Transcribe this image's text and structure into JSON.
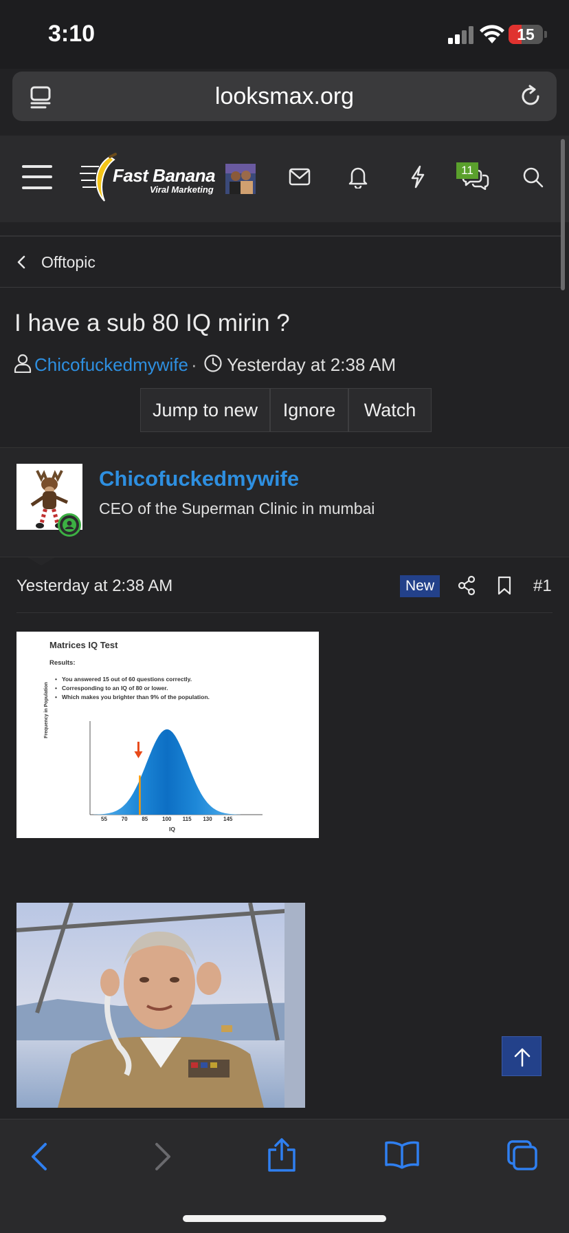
{
  "status_bar": {
    "time": "3:10",
    "battery": "15",
    "battery_level_percent": 15
  },
  "browser": {
    "url": "looksmax.org"
  },
  "header": {
    "logo_line1": "Fast Banana",
    "logo_line2": "Viral Marketing",
    "conversations_badge": "11"
  },
  "breadcrumb": {
    "label": "Offtopic"
  },
  "thread": {
    "title": "I have a sub 80 IQ mirin ?",
    "author": "Chicofuckedmywife",
    "separator": "·",
    "date": "Yesterday at 2:38 AM",
    "buttons": {
      "jump_to_new": "Jump to new",
      "ignore": "Ignore",
      "watch": "Watch"
    }
  },
  "post": {
    "username": "Chicofuckedmywife",
    "user_title": "CEO of the Superman Clinic in mumbai",
    "date": "Yesterday at 2:38 AM",
    "new_badge": "New",
    "number": "#1"
  },
  "iq_image": {
    "title": "Matrices IQ Test",
    "results_label": "Results:",
    "bullets": [
      "You answered 15 out of 60 questions correctly.",
      "Corresponding to an IQ of 80 or lower.",
      "Which makes you brighter than 9% of the population."
    ],
    "y_label": "Frequency in Population",
    "x_label": "IQ",
    "x_ticks": [
      "55",
      "70",
      "85",
      "100",
      "115",
      "130",
      "145"
    ],
    "marker_iq": 80,
    "colors": {
      "curve": "#1e88d8",
      "marker": "#ff9900",
      "arrow": "#e84a1a"
    }
  },
  "icons": {
    "tabs": "tabs-icon",
    "reload": "reload-icon",
    "menu": "hamburger-icon",
    "inbox": "envelope-icon",
    "alerts": "bell-icon",
    "whats_new": "lightning-icon",
    "conversations": "chat-icon",
    "search": "search-icon",
    "back": "chevron-left-icon",
    "share": "share-icon",
    "bookmark": "bookmark-icon",
    "scroll_top": "arrow-up-icon"
  },
  "colors": {
    "link": "#2e8fe0",
    "new_badge": "#23418a",
    "notif_badge": "#5aa02c",
    "battery_low": "#e0322f",
    "online": "#3cb043"
  }
}
